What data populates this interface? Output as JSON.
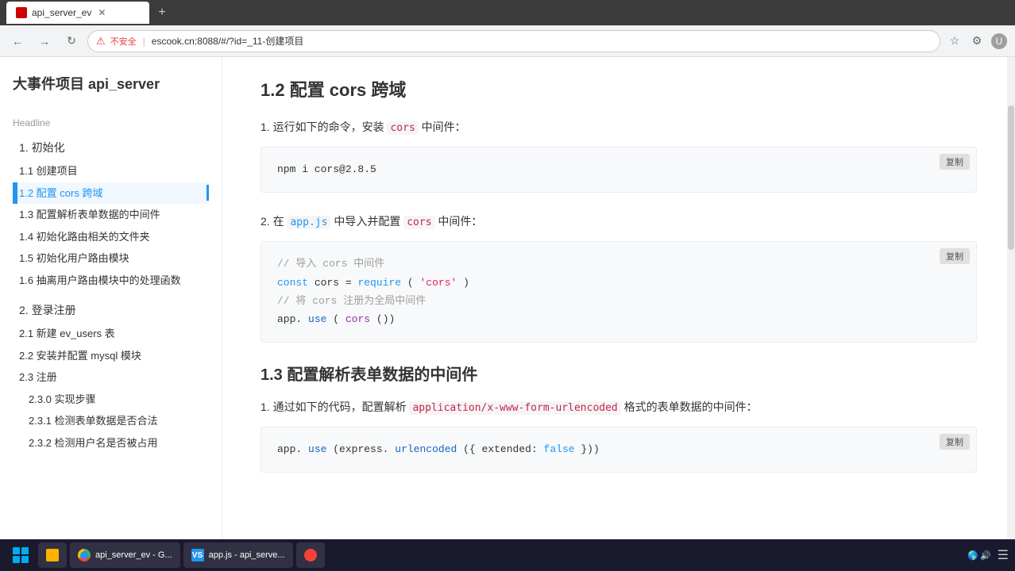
{
  "browser": {
    "tab_title": "api_server_ev",
    "address_insecure": "不安全",
    "address_url": "escook.cn:8088/#/?id=_11-创建项目",
    "new_tab_icon": "+"
  },
  "sidebar": {
    "title": "大事件项目 api_server",
    "headline_label": "Headline",
    "sections": [
      {
        "id": "section-1",
        "label": "1. 初始化",
        "items": [
          {
            "id": "item-1-1",
            "label": "1.1 创建项目",
            "active": false
          },
          {
            "id": "item-1-2",
            "label": "1.2 配置 cors 跨域",
            "active": true
          },
          {
            "id": "item-1-3",
            "label": "1.3 配置解析表单数据的中间件",
            "active": false
          },
          {
            "id": "item-1-4",
            "label": "1.4 初始化路由相关的文件夹",
            "active": false
          },
          {
            "id": "item-1-5",
            "label": "1.5 初始化用户路由模块",
            "active": false
          },
          {
            "id": "item-1-6",
            "label": "1.6 抽离用户路由模块中的处理函数",
            "active": false
          }
        ]
      },
      {
        "id": "section-2",
        "label": "2. 登录注册",
        "items": [
          {
            "id": "item-2-1",
            "label": "2.1 新建 ev_users 表",
            "active": false
          },
          {
            "id": "item-2-2",
            "label": "2.2 安装并配置 mysql 模块",
            "active": false
          },
          {
            "id": "item-2-3",
            "label": "2.3 注册",
            "active": false
          },
          {
            "id": "item-2-3-0",
            "label": "2.3.0 实现步骤",
            "active": false,
            "sub": true
          },
          {
            "id": "item-2-3-1",
            "label": "2.3.1 检测表单数据是否合法",
            "active": false,
            "sub": true
          },
          {
            "id": "item-2-3-2",
            "label": "2.3.2 检测用户名是否被占用",
            "active": false,
            "sub": true
          }
        ]
      }
    ]
  },
  "content": {
    "section_1_2": {
      "title_num": "1.2",
      "title": "配置 cors 跨域",
      "step1_prefix": "运行如下的命令，安装",
      "step1_code": "cors",
      "step1_suffix": "中间件：",
      "code_block_1": "npm i cors@2.8.5",
      "step2_prefix": "在",
      "step2_code1": "app.js",
      "step2_middle": "中导入并配置",
      "step2_code2": "cors",
      "step2_suffix": "中间件：",
      "code_block_2_lines": [
        "// 导入 cors 中间件",
        "const cors = require('cors')",
        "// 将 cors 注册为全局中间件",
        "app.use(cors())"
      ]
    },
    "section_1_3": {
      "title_num": "1.3",
      "title": "配置解析表单数据的中间件",
      "step1_prefix": "通过如下的代码，配置解析",
      "step1_code": "application/x-www-form-urlencoded",
      "step1_suffix": "格式的表单数据的中间件：",
      "code_block_1": "app.use(express.urlencoded({ extended: false }))"
    }
  },
  "taskbar": {
    "items": [
      {
        "id": "tb-1",
        "label": "api_server_ev - G...",
        "icon_color": "#4CAF50"
      },
      {
        "id": "tb-2",
        "label": "app.js - api_serve...",
        "icon_color": "#2196F3"
      },
      {
        "id": "tb-3",
        "label": "",
        "icon_color": "#f44336"
      }
    ]
  }
}
